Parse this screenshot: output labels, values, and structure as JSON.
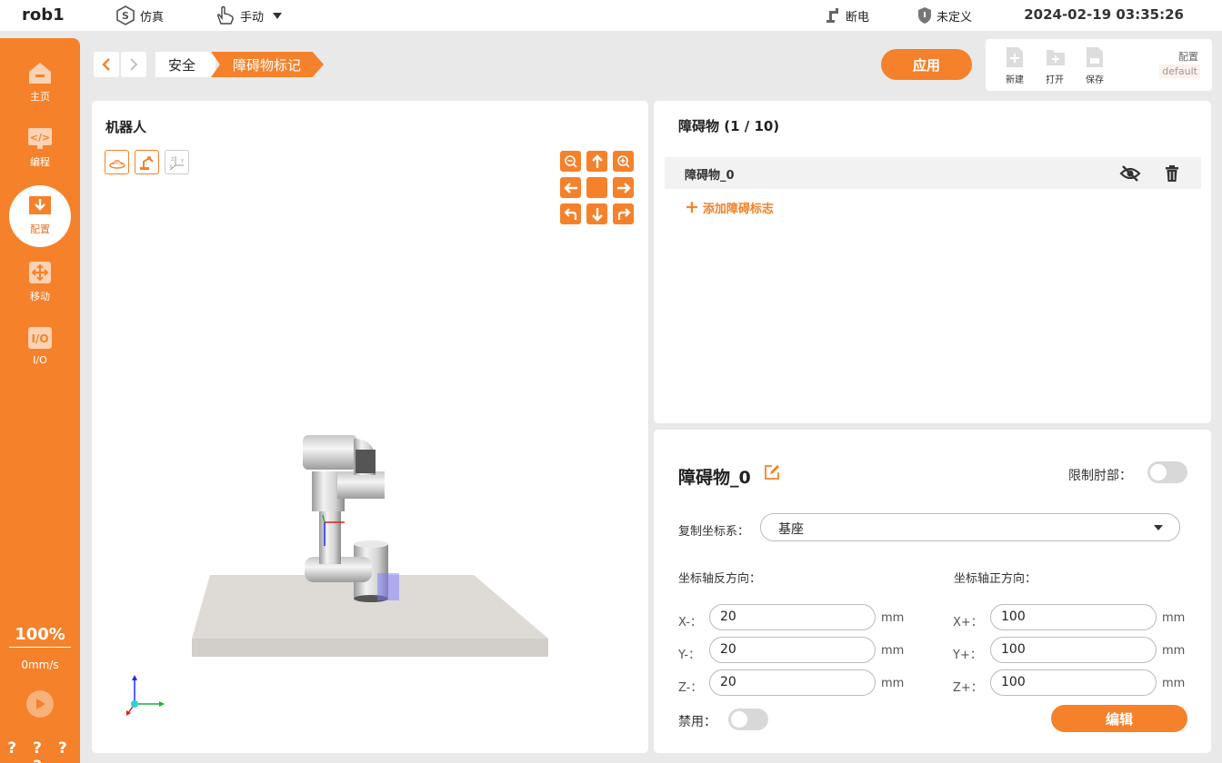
{
  "topbar": {
    "robot_name": "rob1",
    "mode_label": "仿真",
    "control_label": "手动",
    "power_label": "断电",
    "safety_label": "未定义",
    "datetime": "2024-02-19 03:35:26"
  },
  "sidebar": {
    "items": [
      {
        "label": "主页",
        "icon": "home-icon"
      },
      {
        "label": "编程",
        "icon": "code-icon"
      },
      {
        "label": "配置",
        "icon": "config-icon"
      },
      {
        "label": "移动",
        "icon": "move-icon"
      },
      {
        "label": "I/O",
        "icon": "io-icon"
      }
    ],
    "active_index": 2,
    "speed_percent": "100%",
    "speed_value": "0mm/s",
    "help_text": "? ? ? ?"
  },
  "breadcrumb": [
    "安全",
    "障碍物标记"
  ],
  "toolbar": {
    "apply_label": "应用",
    "new_label": "新建",
    "open_label": "打开",
    "save_label": "保存",
    "config_label": "配置",
    "config_value": "default"
  },
  "robot_panel": {
    "title": "机器人"
  },
  "obstacle_list": {
    "title": "障碍物 (1 / 10)",
    "items": [
      {
        "name": "障碍物_0"
      }
    ],
    "add_label": "添加障碍标志"
  },
  "detail": {
    "title": "障碍物_0",
    "limit_elbow_label": "限制肘部：",
    "limit_elbow_on": false,
    "copy_frame_label": "复制坐标系：",
    "copy_frame_value": "基座",
    "neg_axis_label": "坐标轴反方向：",
    "pos_axis_label": "坐标轴正方向：",
    "neg": [
      {
        "label": "X-：",
        "value": "20",
        "unit": "mm"
      },
      {
        "label": "Y-：",
        "value": "20",
        "unit": "mm"
      },
      {
        "label": "Z-：",
        "value": "20",
        "unit": "mm"
      }
    ],
    "pos": [
      {
        "label": "X+：",
        "value": "100",
        "unit": "mm"
      },
      {
        "label": "Y+：",
        "value": "100",
        "unit": "mm"
      },
      {
        "label": "Z+：",
        "value": "100",
        "unit": "mm"
      }
    ],
    "disable_label": "禁用：",
    "disable_on": false,
    "edit_label": "编辑"
  },
  "colors": {
    "accent": "#f5812a",
    "background": "#e9e9e9"
  }
}
